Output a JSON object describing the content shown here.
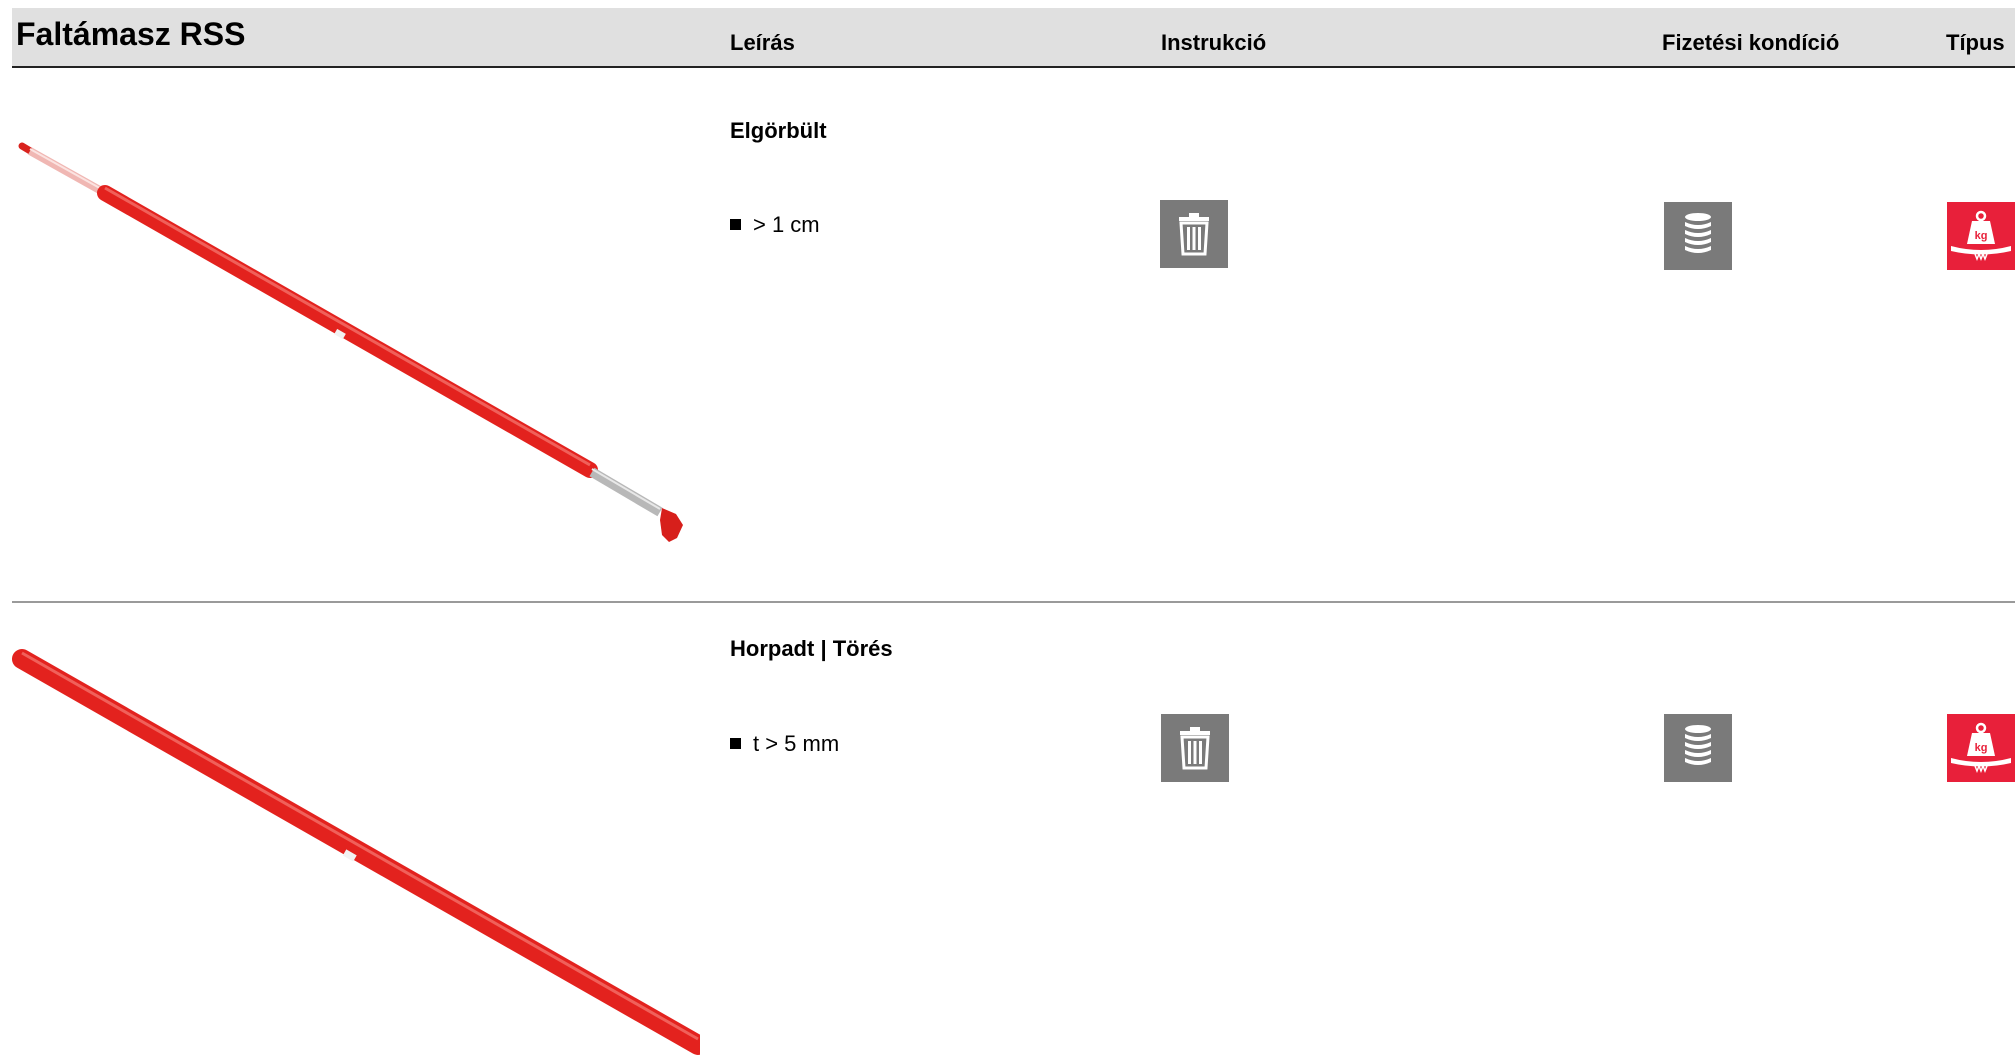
{
  "header": {
    "title": "Faltámasz RSS",
    "columns": {
      "description": "Leírás",
      "instruction": "Instrukció",
      "payment": "Fizetési kondíció",
      "type": "Típus"
    }
  },
  "rows": [
    {
      "title": "Elgörbült",
      "criterion": "> 1 cm",
      "instruction_icon": "trash-icon",
      "payment_icon": "coin-stack-icon",
      "type_icon": "weight-kg-icon",
      "type_icon_color": "#e8203a"
    },
    {
      "title": "Horpadt | Törés",
      "criterion": "t > 5 mm",
      "instruction_icon": "trash-icon",
      "payment_icon": "coin-stack-icon",
      "type_icon": "weight-kg-icon",
      "type_icon_color": "#e8203a"
    }
  ],
  "icon_labels": {
    "kg": "kg"
  },
  "colors": {
    "header_bg": "#e0e0e0",
    "icon_gray": "#7a7a7a",
    "accent_red": "#e8203a",
    "prop_red": "#e3221e"
  }
}
